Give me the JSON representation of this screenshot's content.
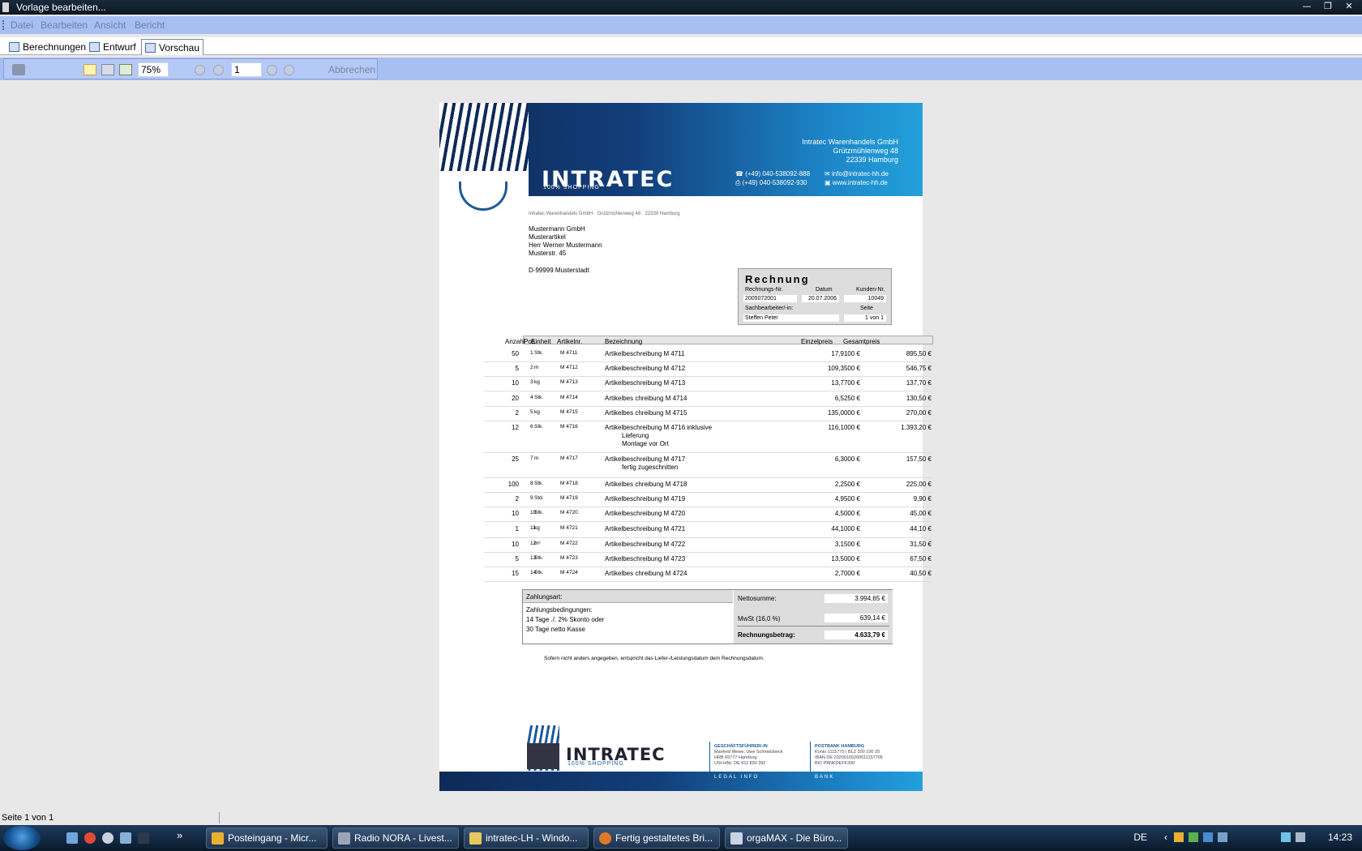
{
  "window": {
    "title": "Vorlage bearbeiten..."
  },
  "menu": [
    "Datei",
    "Bearbeiten",
    "Ansicht",
    "Bericht"
  ],
  "tabs": [
    "Berechnungen",
    "Entwurf",
    "Vorschau"
  ],
  "toolbar": {
    "zoom": "75%",
    "page": "1",
    "cancel_label": "Abbrechen"
  },
  "document": {
    "logo_text": "INTRATEC",
    "logo_sub": "100% SHOPPING",
    "company": [
      "Intratec Warenhandels GmbH",
      "Grützmühlenweg 48",
      "22339 Hamburg"
    ],
    "phone": "(+49) 040-538092-888",
    "fax": "(+49) 040-538092-930",
    "email": "info@intratec-hh.de",
    "web": "www.intratec-hh.de",
    "sender_line": "Intratec Warenhandels GmbH · Grützmühlenweg 48 · 22339 Hamburg",
    "recipient": [
      "Mustermann GmbH",
      "Musterartikel",
      "Herr Werner Mustermann",
      "Musterstr. 45"
    ],
    "recipient_city": "D-99999 Musterstadt",
    "invoice": {
      "title": "Rechnung",
      "number_label": "Rechnungs-Nr.",
      "number": "2005072001",
      "date_label": "Datum",
      "date": "20.07.2006",
      "customer_label": "Kunden-Nr.",
      "customer": "10049",
      "clerk_label": "Sachbearbeiter/-in:",
      "clerk": "Steffen Peter",
      "page_label": "Seite",
      "page": "1 von 1"
    },
    "table_headers": {
      "qty": "Anzahl",
      "pos": "Pos.",
      "unit": "Einheit",
      "article": "Artikelnr.",
      "desc": "Bezeichnung",
      "unit_price": "Einzelpreis",
      "total": "Gesamtpreis"
    },
    "rows": [
      {
        "pos": "1",
        "qty": "50",
        "unit": "Stk.",
        "article": "M 4711",
        "desc": "Artikelbeschreibung  M 4711",
        "extra": "",
        "extra2": "",
        "price": "17,9100 €",
        "total": "895,50 €"
      },
      {
        "pos": "2",
        "qty": "5",
        "unit": "m",
        "article": "M 4712",
        "desc": "Artikelbeschreibung  M 4712",
        "extra": "",
        "extra2": "",
        "price": "109,3500 €",
        "total": "546,75 €"
      },
      {
        "pos": "3",
        "qty": "10",
        "unit": "kg",
        "article": "M 4713",
        "desc": "Artikelbeschreibung  M 4713",
        "extra": "",
        "extra2": "",
        "price": "13,7700 €",
        "total": "137,70 €"
      },
      {
        "pos": "4",
        "qty": "20",
        "unit": "Stk.",
        "article": "M 4714",
        "desc": "Artikelbes chreibung M 4714",
        "extra": "",
        "extra2": "",
        "price": "6,5250 €",
        "total": "130,50 €"
      },
      {
        "pos": "5",
        "qty": "2",
        "unit": "kg",
        "article": "M 4715",
        "desc": "Artikelbes chreibung M 4715",
        "extra": "",
        "extra2": "",
        "price": "135,0000 €",
        "total": "270,00 €"
      },
      {
        "pos": "6",
        "qty": "12",
        "unit": "Stk.",
        "article": "M 4716",
        "desc": "Artikelbeschreibung M 4716 inklusive",
        "extra": "Lieferung",
        "extra2": "Montage vor Ort",
        "price": "116,1000 €",
        "total": "1.393,20 €"
      },
      {
        "pos": "7",
        "qty": "25",
        "unit": "m",
        "article": "M 4717",
        "desc": "Artikelbeschreibung M 4717",
        "extra": "fertig zugeschnitten",
        "extra2": "",
        "price": "6,3000 €",
        "total": "157,50 €"
      },
      {
        "pos": "8",
        "qty": "100",
        "unit": "Stk.",
        "article": "M 4718",
        "desc": "Artikelbes chreibung M 4718",
        "extra": "",
        "extra2": "",
        "price": "2,2500 €",
        "total": "225,00 €"
      },
      {
        "pos": "9",
        "qty": "2",
        "unit": "Std.",
        "article": "M 4719",
        "desc": "Artikelbeschreibung M 4719",
        "extra": "",
        "extra2": "",
        "price": "4,9500 €",
        "total": "9,90 €"
      },
      {
        "pos": "10",
        "qty": "10",
        "unit": "Stk.",
        "article": "M 4720",
        "desc": "Artikelbeschreibung M 4720",
        "extra": "",
        "extra2": "",
        "price": "4,5000 €",
        "total": "45,00 €"
      },
      {
        "pos": "11",
        "qty": "1",
        "unit": "kg",
        "article": "M 4721",
        "desc": "Artikelbeschreibung M 4721",
        "extra": "",
        "extra2": "",
        "price": "44,1000 €",
        "total": "44,10 €"
      },
      {
        "pos": "12",
        "qty": "10",
        "unit": "m²",
        "article": "M 4722",
        "desc": "Artikelbeschreibung M 4722",
        "extra": "",
        "extra2": "",
        "price": "3,1500 €",
        "total": "31,50 €"
      },
      {
        "pos": "13",
        "qty": "5",
        "unit": "Stk.",
        "article": "M 4723",
        "desc": "Artikelbeschreibung M 4723",
        "extra": "",
        "extra2": "",
        "price": "13,5000 €",
        "total": "67,50 €"
      },
      {
        "pos": "14",
        "qty": "15",
        "unit": "Stk.",
        "article": "M 4724",
        "desc": "Artikelbes chreibung M 4724",
        "extra": "",
        "extra2": "",
        "price": "2,7000 €",
        "total": "40,50 €"
      }
    ],
    "payment": {
      "head": "Zahlungsart:",
      "terms_label": "Zahlungsbedingungen:",
      "terms_1": "14 Tage ./. 2% Skonto oder",
      "terms_2": "30 Tage netto Kasse"
    },
    "totals": {
      "net_label": "Nettosumme:",
      "net": "3.994,65 €",
      "vat_label": "MwSt (16,0 %)",
      "vat": "639,14 €",
      "gross_label": "Rechnungsbetrag:",
      "gross": "4.633,79 €"
    },
    "note": "Sofern nicht anders angegeben, entspricht das Liefer-/Leistungsdatum dem Rechnungsdatum.",
    "footer": {
      "col1_head": "GESCHÄFTSFÜHRER/-IN",
      "col1": [
        "Manfred Mewe, Uwe Schmelzbeck",
        "HRB 65777 Hamburg",
        "USt-IdNr. DE 811 830 392"
      ],
      "col2_head": "POSTBANK HAMBURG",
      "col2": [
        "Konto 1115770 | BLZ 200 100 20",
        "IBAN DE 20200100200011157705",
        "BIC PBNKDEFF200"
      ],
      "legal_label": "LEGAL INFO",
      "bank_label": "BANK"
    }
  },
  "status": {
    "page_text": "Seite 1 von 1"
  },
  "taskbar": {
    "tasks": [
      "Posteingang - Micr...",
      "Radio NORA - Livest...",
      "intratec-LH - Windo...",
      "Fertig gestaltetes Bri...",
      "orgaMAX - Die Büro..."
    ],
    "language": "DE",
    "clock": "14:23",
    "more": "»"
  }
}
